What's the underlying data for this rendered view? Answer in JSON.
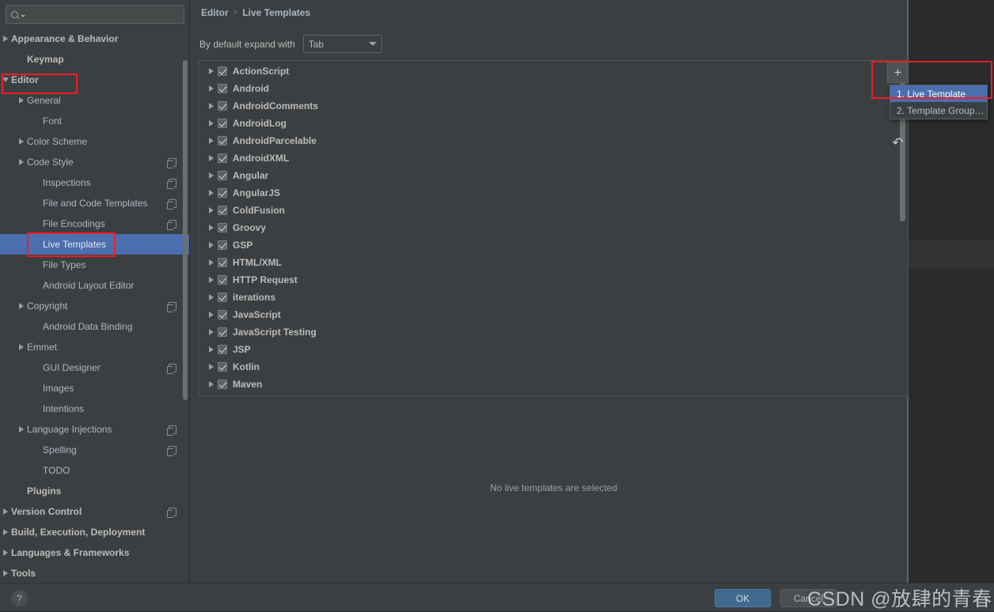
{
  "search": {
    "value": "",
    "placeholder": "",
    "icon": "search-icon"
  },
  "sidebar": {
    "scrollbar": "vertical-scrollbar",
    "items": [
      {
        "label": "Appearance & Behavior",
        "arrow": "right",
        "bold": true,
        "indent": 6,
        "copy": false,
        "selected": false
      },
      {
        "label": "Keymap",
        "arrow": "none",
        "bold": true,
        "indent": 26,
        "copy": false,
        "selected": false
      },
      {
        "label": "Editor",
        "arrow": "down",
        "bold": true,
        "indent": 6,
        "copy": false,
        "selected": false
      },
      {
        "label": "General",
        "arrow": "right",
        "bold": false,
        "indent": 26,
        "copy": false,
        "selected": false
      },
      {
        "label": "Font",
        "arrow": "none",
        "bold": false,
        "indent": 46,
        "copy": false,
        "selected": false
      },
      {
        "label": "Color Scheme",
        "arrow": "right",
        "bold": false,
        "indent": 26,
        "copy": false,
        "selected": false
      },
      {
        "label": "Code Style",
        "arrow": "right",
        "bold": false,
        "indent": 26,
        "copy": true,
        "selected": false
      },
      {
        "label": "Inspections",
        "arrow": "none",
        "bold": false,
        "indent": 46,
        "copy": true,
        "selected": false
      },
      {
        "label": "File and Code Templates",
        "arrow": "none",
        "bold": false,
        "indent": 46,
        "copy": true,
        "selected": false
      },
      {
        "label": "File Encodings",
        "arrow": "none",
        "bold": false,
        "indent": 46,
        "copy": true,
        "selected": false
      },
      {
        "label": "Live Templates",
        "arrow": "none",
        "bold": false,
        "indent": 46,
        "copy": false,
        "selected": true
      },
      {
        "label": "File Types",
        "arrow": "none",
        "bold": false,
        "indent": 46,
        "copy": false,
        "selected": false
      },
      {
        "label": "Android Layout Editor",
        "arrow": "none",
        "bold": false,
        "indent": 46,
        "copy": false,
        "selected": false
      },
      {
        "label": "Copyright",
        "arrow": "right",
        "bold": false,
        "indent": 26,
        "copy": true,
        "selected": false
      },
      {
        "label": "Android Data Binding",
        "arrow": "none",
        "bold": false,
        "indent": 46,
        "copy": false,
        "selected": false
      },
      {
        "label": "Emmet",
        "arrow": "right",
        "bold": false,
        "indent": 26,
        "copy": false,
        "selected": false
      },
      {
        "label": "GUI Designer",
        "arrow": "none",
        "bold": false,
        "indent": 46,
        "copy": true,
        "selected": false
      },
      {
        "label": "Images",
        "arrow": "none",
        "bold": false,
        "indent": 46,
        "copy": false,
        "selected": false
      },
      {
        "label": "Intentions",
        "arrow": "none",
        "bold": false,
        "indent": 46,
        "copy": false,
        "selected": false
      },
      {
        "label": "Language Injections",
        "arrow": "right",
        "bold": false,
        "indent": 26,
        "copy": true,
        "selected": false
      },
      {
        "label": "Spelling",
        "arrow": "none",
        "bold": false,
        "indent": 46,
        "copy": true,
        "selected": false
      },
      {
        "label": "TODO",
        "arrow": "none",
        "bold": false,
        "indent": 46,
        "copy": false,
        "selected": false
      },
      {
        "label": "Plugins",
        "arrow": "none",
        "bold": true,
        "indent": 26,
        "copy": false,
        "selected": false
      },
      {
        "label": "Version Control",
        "arrow": "right",
        "bold": true,
        "indent": 6,
        "copy": true,
        "selected": false
      },
      {
        "label": "Build, Execution, Deployment",
        "arrow": "right",
        "bold": true,
        "indent": 6,
        "copy": false,
        "selected": false
      },
      {
        "label": "Languages & Frameworks",
        "arrow": "right",
        "bold": true,
        "indent": 6,
        "copy": false,
        "selected": false
      },
      {
        "label": "Tools",
        "arrow": "right",
        "bold": true,
        "indent": 6,
        "copy": false,
        "selected": false
      }
    ]
  },
  "breadcrumb": {
    "root": "Editor",
    "separator": "›",
    "current": "Live Templates"
  },
  "expand": {
    "label": "By default expand with",
    "value": "Tab"
  },
  "templates": {
    "rows": [
      {
        "label": "ActionScript",
        "checked": true
      },
      {
        "label": "Android",
        "checked": true
      },
      {
        "label": "AndroidComments",
        "checked": true
      },
      {
        "label": "AndroidLog",
        "checked": true
      },
      {
        "label": "AndroidParcelable",
        "checked": true
      },
      {
        "label": "AndroidXML",
        "checked": true
      },
      {
        "label": "Angular",
        "checked": true
      },
      {
        "label": "AngularJS",
        "checked": true
      },
      {
        "label": "ColdFusion",
        "checked": true
      },
      {
        "label": "Groovy",
        "checked": true
      },
      {
        "label": "GSP",
        "checked": true
      },
      {
        "label": "HTML/XML",
        "checked": true
      },
      {
        "label": "HTTP Request",
        "checked": true
      },
      {
        "label": "iterations",
        "checked": true
      },
      {
        "label": "JavaScript",
        "checked": true
      },
      {
        "label": "JavaScript Testing",
        "checked": true
      },
      {
        "label": "JSP",
        "checked": true
      },
      {
        "label": "Kotlin",
        "checked": true
      },
      {
        "label": "Maven",
        "checked": true
      }
    ]
  },
  "toolbar": {
    "add_label": "+",
    "undo_label": "↶"
  },
  "popup": {
    "items": [
      {
        "label": "1. Live Template",
        "active": true
      },
      {
        "label": "2. Template Group…",
        "active": false
      }
    ]
  },
  "empty_state": {
    "message": "No live templates are selected"
  },
  "footer": {
    "help_label": "?",
    "ok_label": "OK",
    "cancel_label": "Cancel"
  },
  "watermark": {
    "text": "CSDN @放肆的青春 ˇつ"
  },
  "colors": {
    "dialog_bg": "#3c3f41",
    "selection_blue": "#4b6eaf",
    "annotation_red": "#ee1c25",
    "ok_button": "#40698f",
    "editor_bg": "#2b2b2b"
  }
}
